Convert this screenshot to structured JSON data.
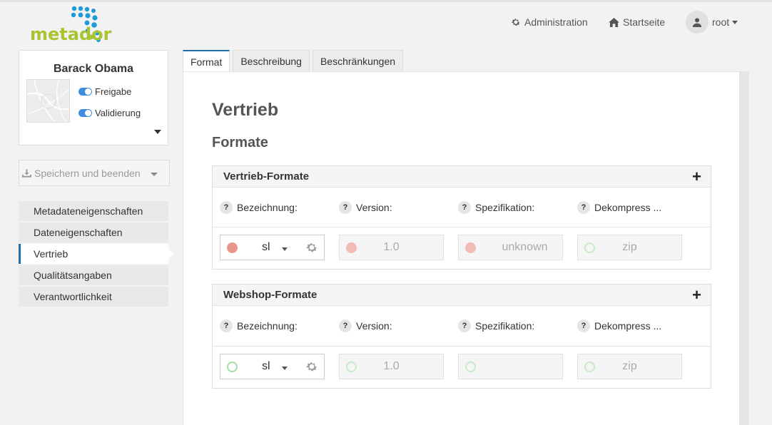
{
  "brand": {
    "name": "metador"
  },
  "header": {
    "admin_label": "Administration",
    "home_label": "Startseite",
    "user_label": "root"
  },
  "record": {
    "title": "Barack Obama",
    "toggles": [
      {
        "label": "Freigabe",
        "on": true
      },
      {
        "label": "Validierung",
        "on": true
      }
    ]
  },
  "save": {
    "label": "Speichern und beenden"
  },
  "sidebar": {
    "items": [
      {
        "label": "Metadateneigenschaften",
        "active": false
      },
      {
        "label": "Dateneigenschaften",
        "active": false
      },
      {
        "label": "Vertrieb",
        "active": true
      },
      {
        "label": "Qualitätsangaben",
        "active": false
      },
      {
        "label": "Verantwortlichkeit",
        "active": false
      }
    ]
  },
  "tabs": [
    {
      "label": "Format",
      "active": true
    },
    {
      "label": "Beschreibung",
      "active": false
    },
    {
      "label": "Beschränkungen",
      "active": false
    }
  ],
  "main": {
    "title": "Vertrieb",
    "subtitle": "Formate",
    "columns": [
      "Bezeichnung:",
      "Version:",
      "Spezifikation:",
      "Dekompress ..."
    ],
    "sections": [
      {
        "title": "Vertrieb-Formate",
        "add_label": "+",
        "row": {
          "name": "sl",
          "version": "1.0",
          "specification": "unknown",
          "decompression": "zip"
        }
      },
      {
        "title": "Webshop-Formate",
        "add_label": "+",
        "row": {
          "name": "sl",
          "version": "1.0",
          "specification": "",
          "decompression": "zip"
        }
      }
    ]
  },
  "colors": {
    "brand_green": "#a8c431",
    "brand_blue": "#1d9bd7",
    "accent": "#1f6fa8",
    "error_dot": "#e8958a",
    "ok_ring": "#a6dba6"
  }
}
